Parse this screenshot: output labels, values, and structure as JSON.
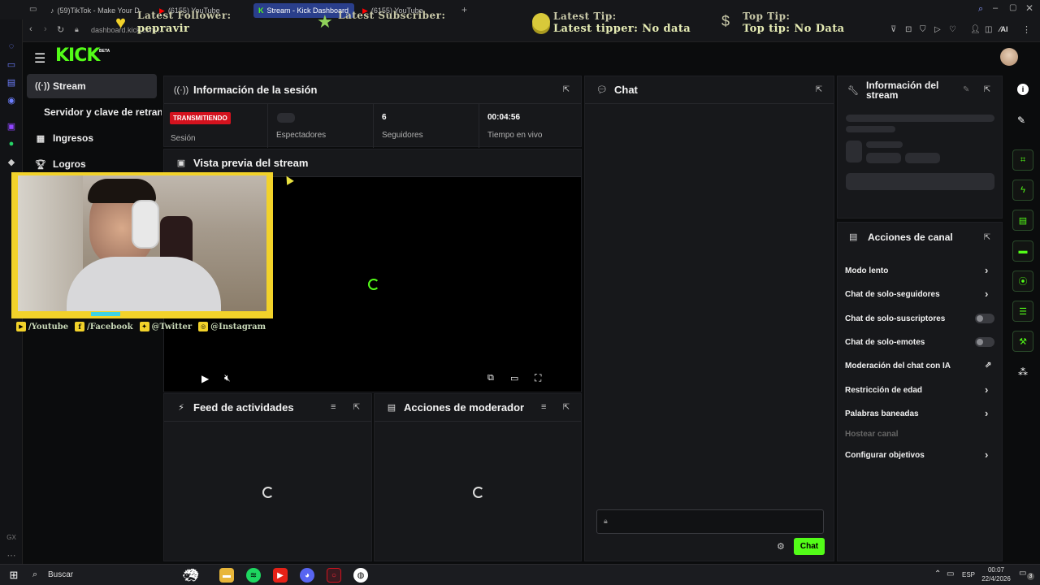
{
  "browser": {
    "tabs": [
      {
        "label": "(59)TikTok - Make Your D"
      },
      {
        "label": "(6155) YouTube"
      },
      {
        "label": "Stream - Kick Dashboard"
      },
      {
        "label": "(6155) YouTube"
      }
    ],
    "url": "dashboard.kick.com/...",
    "ai_label": "AI"
  },
  "overlay": {
    "follower_label": "Latest Follower:",
    "follower_value": "pepravir",
    "subscriber_label": "Latest Subscriber:",
    "tip_label": "Latest Tip:",
    "tip_value": "Latest tipper: No data",
    "top_tip_label": "Top Tip:",
    "top_tip_value": "Top tip: No Data",
    "socials": [
      "/Youtube",
      "/Facebook",
      "@Twitter",
      "@Instagram"
    ]
  },
  "kick": {
    "logo": "KICK",
    "logo_badge": "BETA",
    "sidebar": [
      {
        "label": "Stream",
        "icon": "broadcast-icon"
      },
      {
        "label": "Servidor y clave de retransmisión",
        "icon": ""
      },
      {
        "label": "Ingresos",
        "icon": "revenue-icon"
      },
      {
        "label": "Logros",
        "icon": "trophy-icon"
      }
    ],
    "session": {
      "title": "Información de la sesión",
      "badge": "TRANSMITIENDO",
      "session_label": "Sesión",
      "viewers_label": "Espectadores",
      "followers_value": "6",
      "followers_label": "Seguidores",
      "uptime_value": "00:04:56",
      "uptime_label": "Tiempo en vivo"
    },
    "preview": {
      "title": "Vista previa del stream"
    },
    "activity": {
      "title": "Feed de actividades"
    },
    "moderator": {
      "title": "Acciones de moderador"
    },
    "chat": {
      "title": "Chat",
      "send_label": "Chat"
    },
    "stream_info": {
      "title_line1": "Información del",
      "title_line2": "stream"
    },
    "channel_actions": {
      "title": "Acciones de canal",
      "items": [
        {
          "label": "Modo lento",
          "control": "chevron"
        },
        {
          "label": "Chat de solo-seguidores",
          "control": "chevron"
        },
        {
          "label": "Chat de solo-suscriptores",
          "control": "toggle"
        },
        {
          "label": "Chat de solo-emotes",
          "control": "toggle"
        },
        {
          "label": "Moderación del chat con IA",
          "control": "external"
        },
        {
          "label": "Restricción de edad",
          "control": "chevron"
        },
        {
          "label": "Palabras baneadas",
          "control": "chevron"
        },
        {
          "label": "Hostear canal",
          "control": "none"
        },
        {
          "label": "Configurar objetivos",
          "control": "chevron"
        }
      ]
    }
  },
  "taskbar": {
    "search_label": "Buscar",
    "lang": "ESP",
    "time": "00:07",
    "date": "22/4/2026",
    "notif_count": "3"
  },
  "colors": {
    "accent": "#53fc18",
    "badge_red": "#d4121e",
    "panel": "#17181b"
  }
}
